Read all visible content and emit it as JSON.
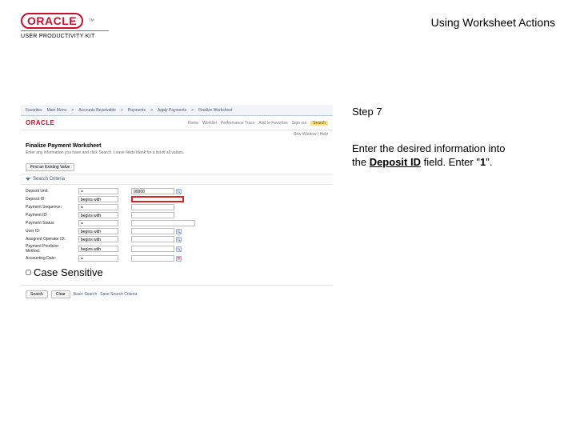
{
  "brand": {
    "mark": "ORACLE",
    "tm": "™",
    "subline": "USER PRODUCTIVITY KIT"
  },
  "document_title": "Using Worksheet Actions",
  "step": {
    "label": "Step 7",
    "line1": "Enter the desired information into",
    "line2_a": "the ",
    "field_name": "Deposit ID",
    "line2_b": " field. Enter \"",
    "value": "1",
    "line2_c": "\"."
  },
  "app": {
    "topnav": [
      "Favorites",
      "Main Menu",
      "Accounts Receivable",
      "Payments",
      "Apply Payments",
      "Finalize Worksheet"
    ],
    "brand_mini": "ORACLE",
    "tabs": [
      "Home",
      "Worklist",
      "Performance Trace",
      "Add to Favorites",
      "Sign out"
    ],
    "search_tab": "Search",
    "status_right": "New Window | Help",
    "page_heading": "Finalize Payment Worksheet",
    "page_desc": "Enter any information you have and click Search. Leave fields blank for a list of all values.",
    "inner_tab": "Find an Existing Value",
    "section_title": "Search Criteria",
    "buttons": [
      "Search",
      "Clear",
      "Basic Search",
      "Save Search Criteria"
    ],
    "checkbox_label": "Case Sensitive",
    "fields": [
      {
        "label": "Deposit Unit:",
        "op": "=",
        "val": "00000",
        "lookup": true
      },
      {
        "label": "Deposit ID:",
        "op": "begins with",
        "val": "",
        "hl": true
      },
      {
        "label": "Payment Sequence:",
        "op": "=",
        "val": ""
      },
      {
        "label": "Payment ID:",
        "op": "begins with",
        "val": ""
      },
      {
        "label": "Payment Status:",
        "op": "=",
        "val": "",
        "dropdown": true
      },
      {
        "label": "User ID:",
        "op": "begins with",
        "val": "",
        "lookup": true
      },
      {
        "label": "Assigned Operator ID:",
        "op": "begins with",
        "val": "",
        "lookup": true
      },
      {
        "label": "Payment Predictor Method:",
        "op": "begins with",
        "val": "",
        "lookup": true
      },
      {
        "label": "Accounting Date:",
        "op": "=",
        "val": "",
        "calendar": true
      }
    ]
  }
}
